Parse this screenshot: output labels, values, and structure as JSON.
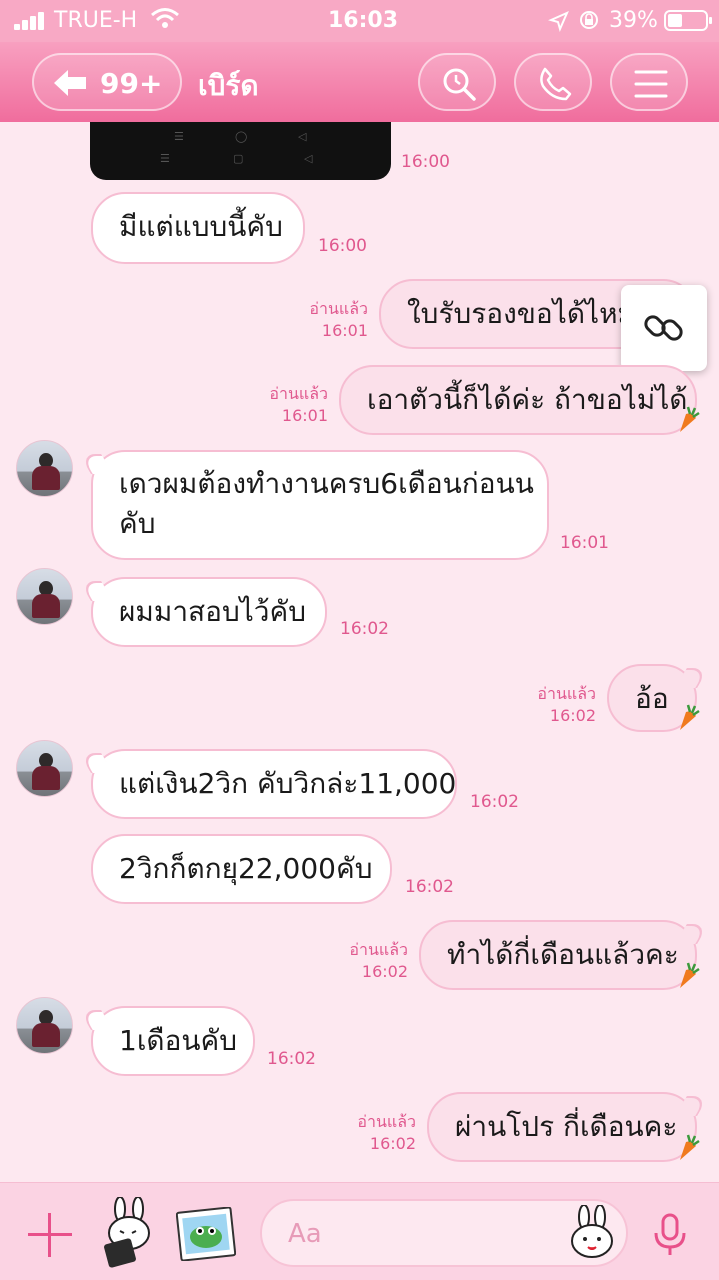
{
  "status_bar": {
    "carrier": "TRUE-H",
    "time": "16:03",
    "battery": "39%",
    "battery_level": 0.39
  },
  "header": {
    "back_count": "99+",
    "title": "เบิร์ด",
    "icons": [
      "search-icon",
      "phone-icon",
      "menu-icon"
    ]
  },
  "messages": [
    {
      "side": "in",
      "text": "",
      "time": "16:00"
    },
    {
      "side": "in",
      "text": "มีแต่แบบนี้คับ",
      "time": "16:00"
    },
    {
      "side": "out",
      "read": "อ่านแล้ว",
      "time": "16:01",
      "text": "ใบรับรองขอได้ไหมคะ"
    },
    {
      "side": "out",
      "read": "อ่านแล้ว",
      "time": "16:01",
      "text": "เอาตัวนี้ก็ได้ค่ะ ถ้าขอไม่ได้"
    },
    {
      "side": "in",
      "lines": [
        "เดวผมต้องทำงานครบ6เดือนก่อนน",
        "คับ"
      ],
      "time": "16:01"
    },
    {
      "side": "in",
      "text": "ผมมาสอบไว้คับ",
      "time": "16:02"
    },
    {
      "side": "out",
      "read": "อ่านแล้ว",
      "time": "16:02",
      "text": "อ้อ"
    },
    {
      "side": "in",
      "text": "แต่เงิน2วิก คับวิกล่ะ11,000",
      "time": "16:02"
    },
    {
      "side": "in",
      "text": "2วิกก็ตกยุ22,000คับ",
      "time": "16:02"
    },
    {
      "side": "out",
      "read": "อ่านแล้ว",
      "time": "16:02",
      "text": "ทำได้กี่เดือนแล้วคะ"
    },
    {
      "side": "in",
      "text": "1เดือนคับ",
      "time": "16:02"
    },
    {
      "side": "out",
      "read": "อ่านแล้ว",
      "time": "16:02",
      "text": "ผ่านโปร กี่เดือนคะ"
    }
  ],
  "input": {
    "placeholder": "Aa"
  },
  "colors": {
    "header": "#f06d9d",
    "accent": "#e0588e",
    "background": "#fde8f0"
  }
}
